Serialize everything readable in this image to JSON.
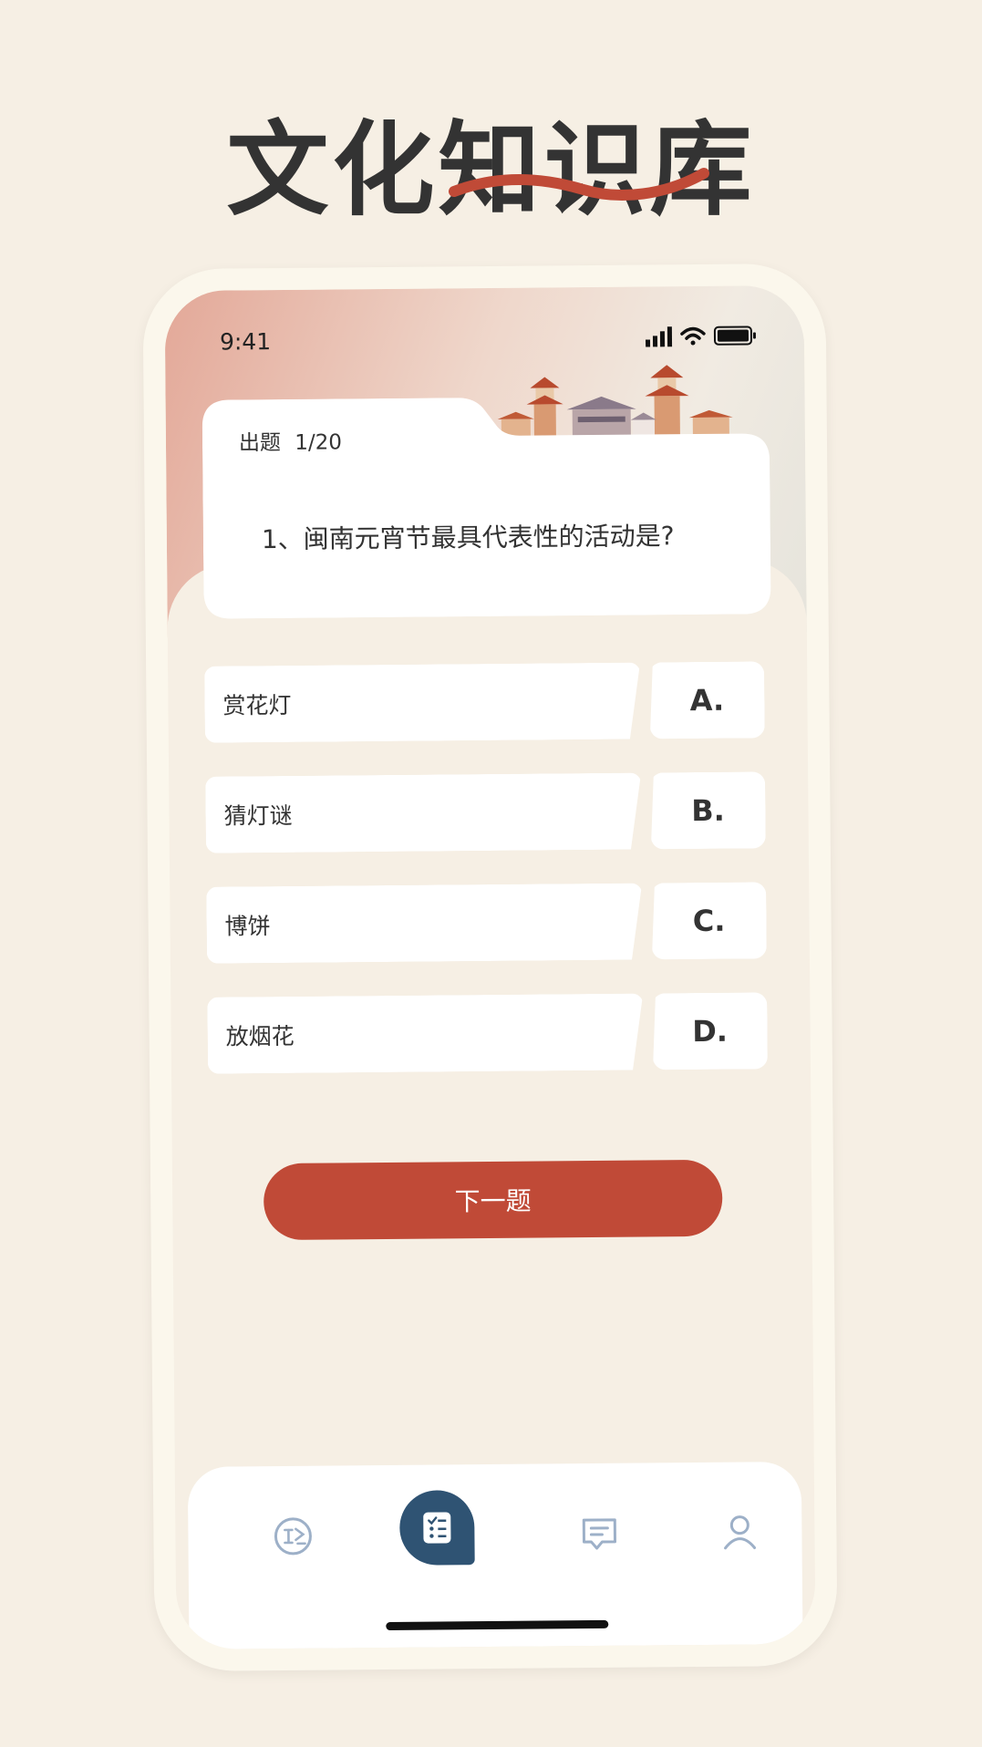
{
  "page": {
    "title": "文化知识库",
    "accent_color": "#c04a37"
  },
  "status_bar": {
    "time": "9:41"
  },
  "quiz": {
    "label": "出题",
    "progress": "1/20",
    "question": "1、闽南元宵节最具代表性的活动是?",
    "options": [
      {
        "letter": "A.",
        "text": "赏花灯"
      },
      {
        "letter": "B.",
        "text": "猜灯谜"
      },
      {
        "letter": "C.",
        "text": "博饼"
      },
      {
        "letter": "D.",
        "text": "放烟花"
      }
    ],
    "next_label": "下一题"
  },
  "tab_bar": {
    "tabs": [
      {
        "icon": "translate-icon",
        "active": false
      },
      {
        "icon": "quiz-list-icon",
        "active": true
      },
      {
        "icon": "chat-icon",
        "active": false
      },
      {
        "icon": "user-icon",
        "active": false
      }
    ]
  }
}
